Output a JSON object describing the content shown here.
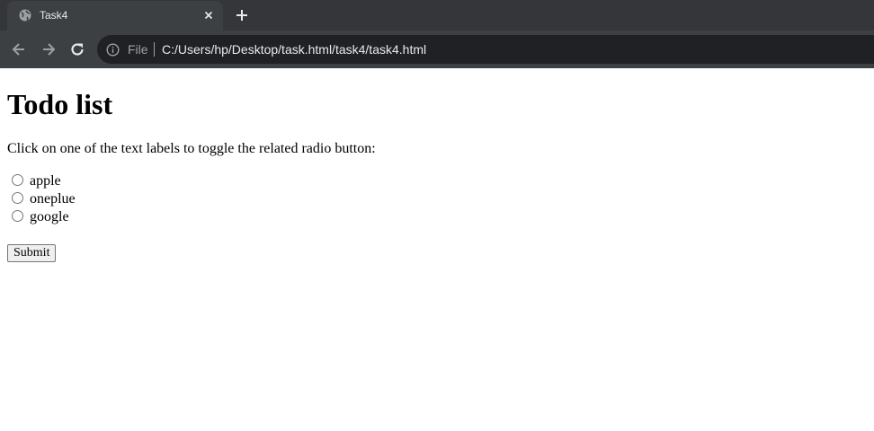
{
  "browser": {
    "tab": {
      "title": "Task4"
    },
    "address_bar": {
      "scheme_label": "File",
      "url": "C:/Users/hp/Desktop/task.html/task4/task4.html"
    },
    "colors": {
      "tabstrip": "#35363a",
      "toolbar": "#3c4043",
      "omnibox": "#202124",
      "text": "#e8eaed"
    }
  },
  "page": {
    "heading": "Todo list",
    "instructions": "Click on one of the text labels to toggle the related radio button:",
    "options": [
      {
        "label": "apple",
        "checked": false
      },
      {
        "label": "oneplue",
        "checked": false
      },
      {
        "label": "google",
        "checked": false
      }
    ],
    "submit_label": "Submit"
  }
}
